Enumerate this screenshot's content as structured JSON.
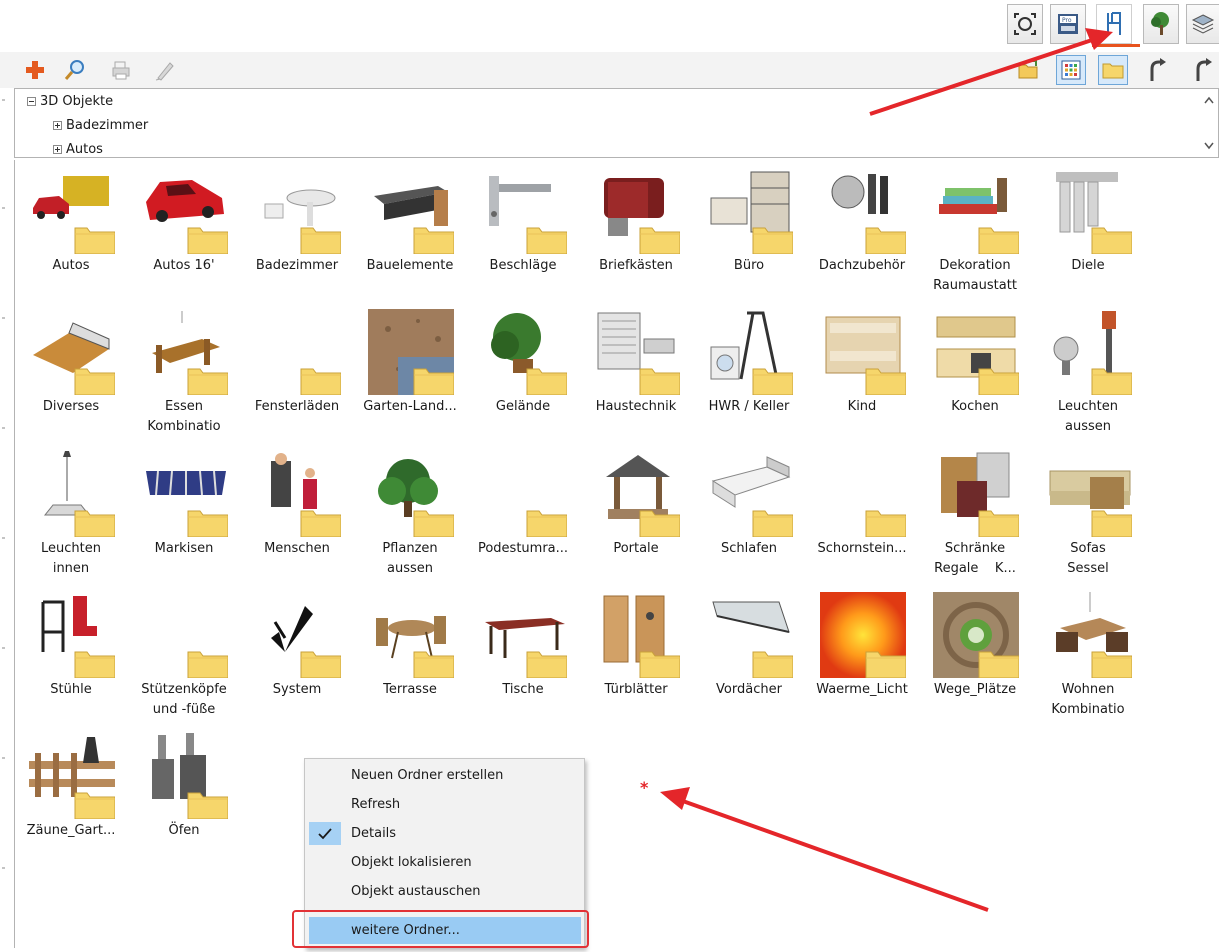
{
  "tree": {
    "root_label": "3D Objekte",
    "children": [
      "Badezimmer",
      "Autos"
    ]
  },
  "grid": {
    "items": [
      {
        "label": "Autos",
        "label2": "",
        "icon": "car-van-icon"
      },
      {
        "label": "Autos 16'",
        "label2": "",
        "icon": "red-sports-car-icon"
      },
      {
        "label": "Badezimmer",
        "label2": "",
        "icon": "sink-toilet-icon"
      },
      {
        "label": "Bauelemente",
        "label2": "",
        "icon": "beam-icon"
      },
      {
        "label": "Beschläge",
        "label2": "",
        "icon": "door-handle-icon"
      },
      {
        "label": "Briefkästen",
        "label2": "",
        "icon": "mailbox-icon"
      },
      {
        "label": "Büro",
        "label2": "",
        "icon": "office-shelf-icon"
      },
      {
        "label": "Dachzubehör",
        "label2": "",
        "icon": "satellite-dish-icon"
      },
      {
        "label": "Dekoration",
        "label2": "Raumaustatt",
        "icon": "cushions-icon"
      },
      {
        "label": "Diele",
        "label2": "",
        "icon": "coat-rack-icon"
      },
      {
        "label": "Diverses",
        "label2": "",
        "icon": "box-crate-icon"
      },
      {
        "label": "Essen",
        "label2": "Kombinatio",
        "icon": "dining-set-icon"
      },
      {
        "label": "Fensterläden",
        "label2": "",
        "icon": "folder-only-icon"
      },
      {
        "label": "Garten-Land...",
        "label2": "",
        "icon": "terrain-texture-icon"
      },
      {
        "label": "Gelände",
        "label2": "",
        "icon": "tree-pot-icon"
      },
      {
        "label": "Haustechnik",
        "label2": "",
        "icon": "radiator-icon"
      },
      {
        "label": "HWR / Keller",
        "label2": "",
        "icon": "washing-machine-ladder-icon"
      },
      {
        "label": "Kind",
        "label2": "",
        "icon": "bunk-bed-icon"
      },
      {
        "label": "Kochen",
        "label2": "",
        "icon": "kitchen-icon"
      },
      {
        "label": "Leuchten",
        "label2": "aussen",
        "icon": "outdoor-lamp-icon"
      },
      {
        "label": "Leuchten",
        "label2": "innen",
        "icon": "pendant-lamp-icon"
      },
      {
        "label": "Markisen",
        "label2": "",
        "icon": "awning-icon"
      },
      {
        "label": "Menschen",
        "label2": "",
        "icon": "people-icon"
      },
      {
        "label": "Pflanzen",
        "label2": "aussen",
        "icon": "bush-icon"
      },
      {
        "label": "Podestumra...",
        "label2": "",
        "icon": "folder-only-icon"
      },
      {
        "label": "Portale",
        "label2": "",
        "icon": "well-roof-icon"
      },
      {
        "label": "Schlafen",
        "label2": "",
        "icon": "bed-icon"
      },
      {
        "label": "Schornstein...",
        "label2": "",
        "icon": "folder-only-icon"
      },
      {
        "label": "Schränke",
        "label2": "Regale    K...",
        "icon": "cabinet-icon"
      },
      {
        "label": "Sofas",
        "label2": "Sessel",
        "icon": "sofa-icon"
      },
      {
        "label": "Stühle",
        "label2": "",
        "icon": "chairs-icon"
      },
      {
        "label": "Stützenköpfe",
        "label2": "und -füße",
        "icon": "folder-only-icon"
      },
      {
        "label": "System",
        "label2": "",
        "icon": "north-arrow-icon"
      },
      {
        "label": "Terrasse",
        "label2": "",
        "icon": "patio-set-icon"
      },
      {
        "label": "Tische",
        "label2": "",
        "icon": "table-icon"
      },
      {
        "label": "Türblätter",
        "label2": "",
        "icon": "door-leaf-icon"
      },
      {
        "label": "Vordächer",
        "label2": "",
        "icon": "canopy-icon"
      },
      {
        "label": "Waerme_Licht",
        "label2": "",
        "icon": "warm-light-gradient-icon"
      },
      {
        "label": "Wege_Plätze",
        "label2": "",
        "icon": "paving-texture-icon"
      },
      {
        "label": "Wohnen",
        "label2": "Kombinatio",
        "icon": "living-set-icon"
      },
      {
        "label": "Zäune_Gart...",
        "label2": "",
        "icon": "fence-icon"
      },
      {
        "label": "Öfen",
        "label2": "",
        "icon": "stove-icon"
      }
    ]
  },
  "context_menu": {
    "items": [
      "Neuen Ordner erstellen",
      "Refresh",
      "Details",
      "Objekt lokalisieren",
      "Objekt austauschen",
      "weitere Ordner..."
    ],
    "checked_item": "Details",
    "highlighted_item": "weitere Ordner..."
  },
  "annotations": {
    "marker": "*",
    "arrow_color": "#e4262a"
  },
  "colors": {
    "folder": "#f6d66b",
    "accent_tab": "#e8531e",
    "menu_highlight": "#99cbf3"
  }
}
